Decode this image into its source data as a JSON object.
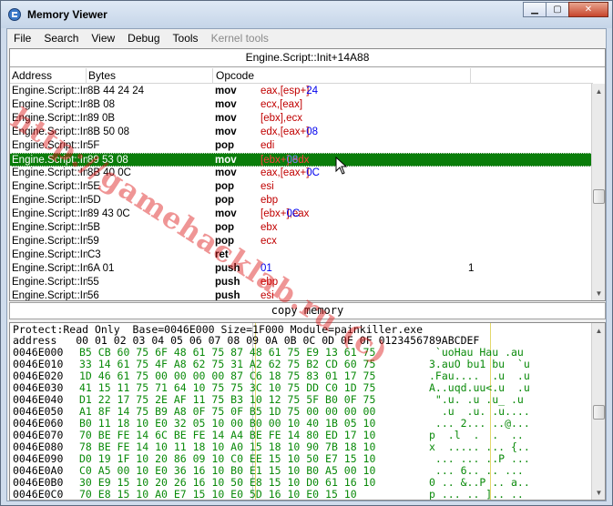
{
  "window": {
    "title": "Memory Viewer"
  },
  "menu": [
    {
      "label": "File",
      "enabled": true
    },
    {
      "label": "Search",
      "enabled": true
    },
    {
      "label": "View",
      "enabled": true
    },
    {
      "label": "Debug",
      "enabled": true
    },
    {
      "label": "Tools",
      "enabled": true
    },
    {
      "label": "Kernel tools",
      "enabled": false
    }
  ],
  "disassembler": {
    "address_header": "Engine.Script::Init+14A88",
    "columns": {
      "address": "Address",
      "bytes": "Bytes",
      "opcode": "Opcode"
    },
    "rows": [
      {
        "address": "Engine.Script::Init",
        "bytes": "8B 44 24 24",
        "mnemonic": "mov",
        "operands": "eax,[esp+24]",
        "extra": ""
      },
      {
        "address": "Engine.Script::Init",
        "bytes": "8B 08",
        "mnemonic": "mov",
        "operands": "ecx,[eax]",
        "extra": ""
      },
      {
        "address": "Engine.Script::Init",
        "bytes": "89 0B",
        "mnemonic": "mov",
        "operands": "[ebx],ecx",
        "extra": ""
      },
      {
        "address": "Engine.Script::Init",
        "bytes": "8B 50 08",
        "mnemonic": "mov",
        "operands": "edx,[eax+08]",
        "extra": ""
      },
      {
        "address": "Engine.Script::Init",
        "bytes": "5F",
        "mnemonic": "pop",
        "operands": "edi",
        "extra": ""
      },
      {
        "address": "Engine.Script::Init",
        "bytes": "89 53 08",
        "mnemonic": "mov",
        "operands": "[ebx+08],edx",
        "extra": "",
        "selected": true
      },
      {
        "address": "Engine.Script::Init",
        "bytes": "8B 40 0C",
        "mnemonic": "mov",
        "operands": "eax,[eax+0C]",
        "extra": ""
      },
      {
        "address": "Engine.Script::Init",
        "bytes": "5E",
        "mnemonic": "pop",
        "operands": "esi",
        "extra": ""
      },
      {
        "address": "Engine.Script::Init",
        "bytes": "5D",
        "mnemonic": "pop",
        "operands": "ebp",
        "extra": ""
      },
      {
        "address": "Engine.Script::Init",
        "bytes": "89 43 0C",
        "mnemonic": "mov",
        "operands": "[ebx+0C],eax",
        "extra": ""
      },
      {
        "address": "Engine.Script::Init",
        "bytes": "5B",
        "mnemonic": "pop",
        "operands": "ebx",
        "extra": ""
      },
      {
        "address": "Engine.Script::Init",
        "bytes": "59",
        "mnemonic": "pop",
        "operands": "ecx",
        "extra": ""
      },
      {
        "address": "Engine.Script::Init",
        "bytes": "C3",
        "mnemonic": "ret",
        "operands": "",
        "extra": ""
      },
      {
        "address": "Engine.Script::Init",
        "bytes": "6A 01",
        "mnemonic": "push",
        "operands": "01",
        "extra": "1"
      },
      {
        "address": "Engine.Script::Init",
        "bytes": "55",
        "mnemonic": "push",
        "operands": "ebp",
        "extra": ""
      },
      {
        "address": "Engine.Script::Init",
        "bytes": "56",
        "mnemonic": "push",
        "operands": "esi",
        "extra": ""
      }
    ]
  },
  "copy_memory_label": "copy memory",
  "hex_view": {
    "info_line": "Protect:Read Only  Base=0046E000 Size=1F000 Module=painkiller.exe",
    "header_line": "address   00 01 02 03 04 05 06 07 08 09 0A 0B 0C 0D 0E 0F 0123456789ABCDEF",
    "rows": [
      {
        "address": "0046E000",
        "bytes": "B5 CB 60 75 6F 48 61 75 87 48 61 75 E9 13 61 75",
        "ascii": " `uoHau Hau .au"
      },
      {
        "address": "0046E010",
        "bytes": "33 14 61 75 4F A8 62 75 31 A2 62 75 B2 CD 60 75",
        "ascii": "3.auO bu1 bu  `u"
      },
      {
        "address": "0046E020",
        "bytes": "1D 46 61 75 00 00 00 00 87 C6 18 75 83 01 17 75",
        "ascii": ".Fau....  .u  .u"
      },
      {
        "address": "0046E030",
        "bytes": "41 15 11 75 71 64 10 75 75 3C 10 75 DD C0 1D 75",
        "ascii": "A..uqd.uu<.u  .u"
      },
      {
        "address": "0046E040",
        "bytes": "D1 22 17 75 2E AF 11 75 B3 10 12 75 5F B0 0F 75",
        "ascii": " \".u. .u .u_ .u"
      },
      {
        "address": "0046E050",
        "bytes": "A1 8F 14 75 B9 A8 0F 75 0F B5 1D 75 00 00 00 00",
        "ascii": "  .u  .u. .u...."
      },
      {
        "address": "0046E060",
        "bytes": "B0 11 18 10 E0 32 05 10 00 B0 00 10 40 1B 05 10",
        "ascii": " ... 2... ..@..."
      },
      {
        "address": "0046E070",
        "bytes": "70 BE FE 14 6C BE FE 14 A4 BE FE 14 80 ED 17 10",
        "ascii": "p  .l  .  .  .."
      },
      {
        "address": "0046E080",
        "bytes": "78 BE FE 14 10 11 18 10 A0 15 18 10 90 7B 18 10",
        "ascii": "x  ..... ... {.."
      },
      {
        "address": "0046E090",
        "bytes": "D0 19 1F 10 20 86 09 10 C0 EE 15 10 50 E7 15 10",
        "ascii": " ... ... ..P ..."
      },
      {
        "address": "0046E0A0",
        "bytes": "C0 A5 00 10 E0 36 16 10 B0 E1 15 10 B0 A5 00 10",
        "ascii": " ... 6.. .. ..."
      },
      {
        "address": "0046E0B0",
        "bytes": "30 E9 15 10 20 26 16 10 50 E8 15 10 D0 61 16 10",
        "ascii": "0 .. &..P .. a.."
      },
      {
        "address": "0046E0C0",
        "bytes": "70 E8 15 10 A0 E7 15 10 E0 5D 16 10 E0 15 10 ",
        "ascii": "p ... .. ].. .."
      }
    ]
  },
  "watermark_text": "http://gamehacklab.ru (c)"
}
